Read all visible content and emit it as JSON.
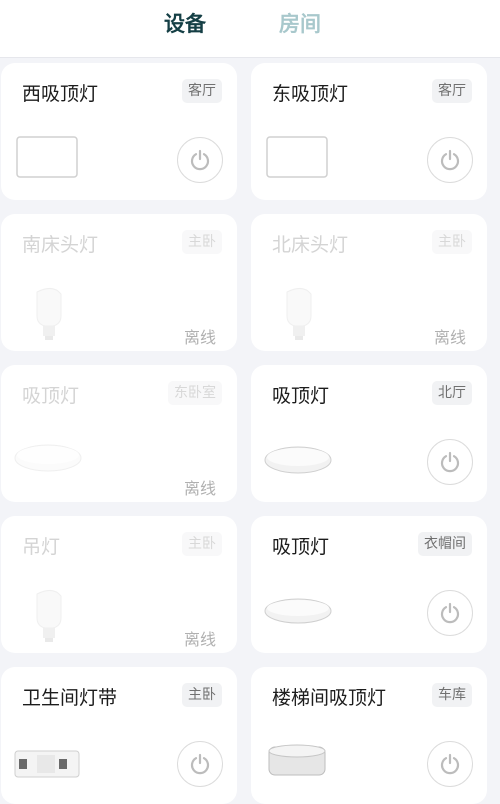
{
  "tabs": {
    "devices": "设备",
    "rooms": "房间"
  },
  "devices": [
    {
      "name": "西吸顶灯",
      "room": "客厅",
      "status": ""
    },
    {
      "name": "东吸顶灯",
      "room": "客厅",
      "status": ""
    },
    {
      "name": "南床头灯",
      "room": "主卧",
      "status": "离线"
    },
    {
      "name": "北床头灯",
      "room": "主卧",
      "status": "离线"
    },
    {
      "name": "吸顶灯",
      "room": "东卧室",
      "status": "离线"
    },
    {
      "name": "吸顶灯",
      "room": "北厅",
      "status": ""
    },
    {
      "name": "吊灯",
      "room": "主卧",
      "status": "离线"
    },
    {
      "name": "吸顶灯",
      "room": "衣帽间",
      "status": ""
    },
    {
      "name": "卫生间灯带",
      "room": "主卧",
      "status": ""
    },
    {
      "name": "楼梯间吸顶灯",
      "room": "车库",
      "status": ""
    }
  ],
  "icons": {
    "power": "power-icon",
    "panel": "square-panel-icon",
    "bulb": "bulb-icon",
    "ceiling": "ceiling-light-icon",
    "strip": "light-strip-controller-icon",
    "round_ceiling": "round-ceiling-light-icon"
  }
}
